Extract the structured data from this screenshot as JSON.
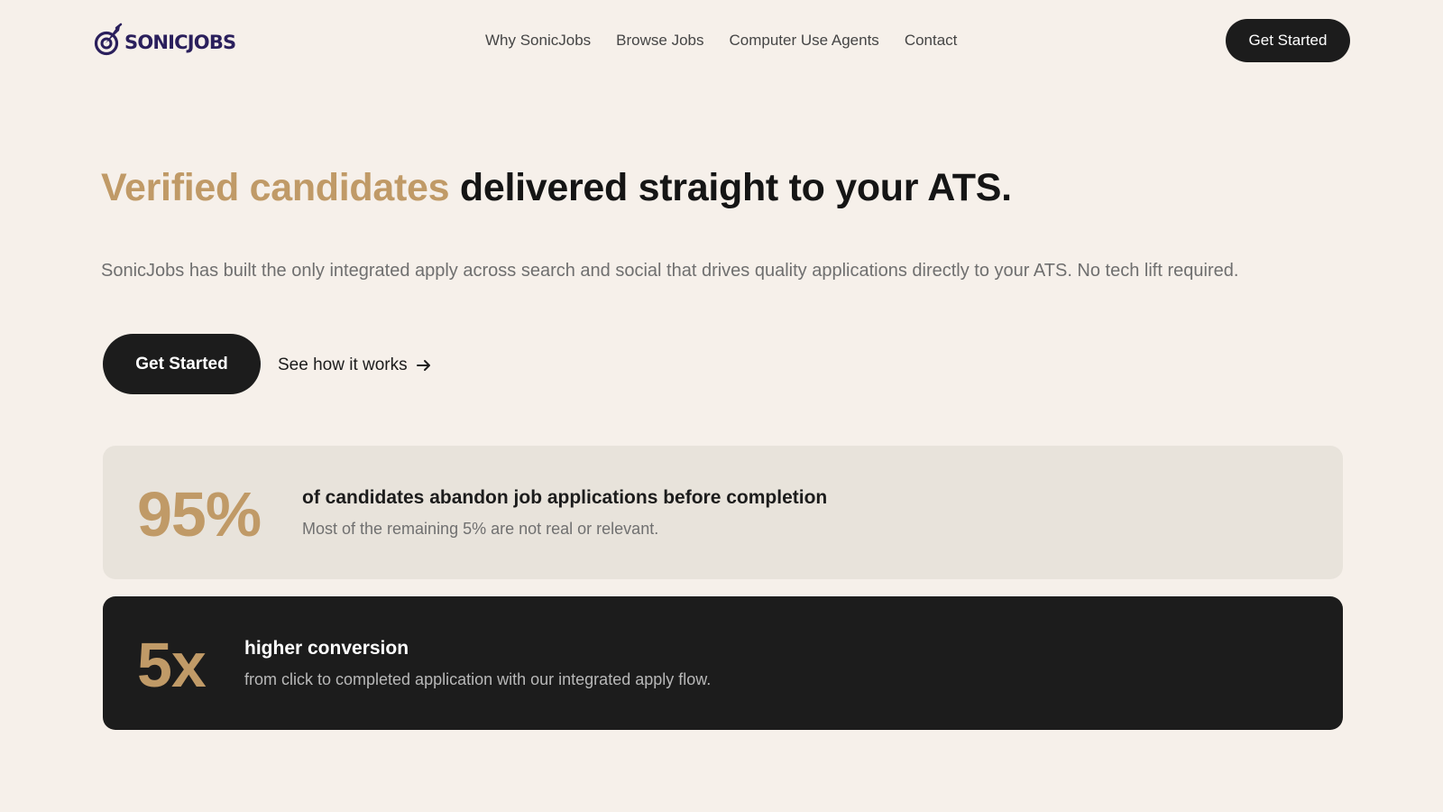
{
  "brand": {
    "name": "SONICJOBS",
    "colors": {
      "accent": "#c09a67",
      "dark": "#1c1c1c",
      "background": "#f6f0ea",
      "logo": "#2a1f5c"
    }
  },
  "nav": {
    "items": [
      "Why SonicJobs",
      "Browse Jobs",
      "Computer Use Agents",
      "Contact"
    ],
    "cta_label": "Get Started"
  },
  "hero": {
    "title_accent": "Verified candidates",
    "title_rest": "delivered straight to your ATS.",
    "subtitle": "SonicJobs has built the only integrated apply across search and social that drives quality applications directly to your ATS. No tech lift required.",
    "primary_cta": "Get Started",
    "secondary_cta": "See how it works",
    "secondary_icon": "arrow-right-icon"
  },
  "stats": [
    {
      "value": "95%",
      "title": "of candidates abandon job applications before completion",
      "description": "Most of the remaining 5% are not real or relevant."
    },
    {
      "value": "5x",
      "title": "higher conversion",
      "description": "from click to completed application with our integrated apply flow."
    }
  ]
}
